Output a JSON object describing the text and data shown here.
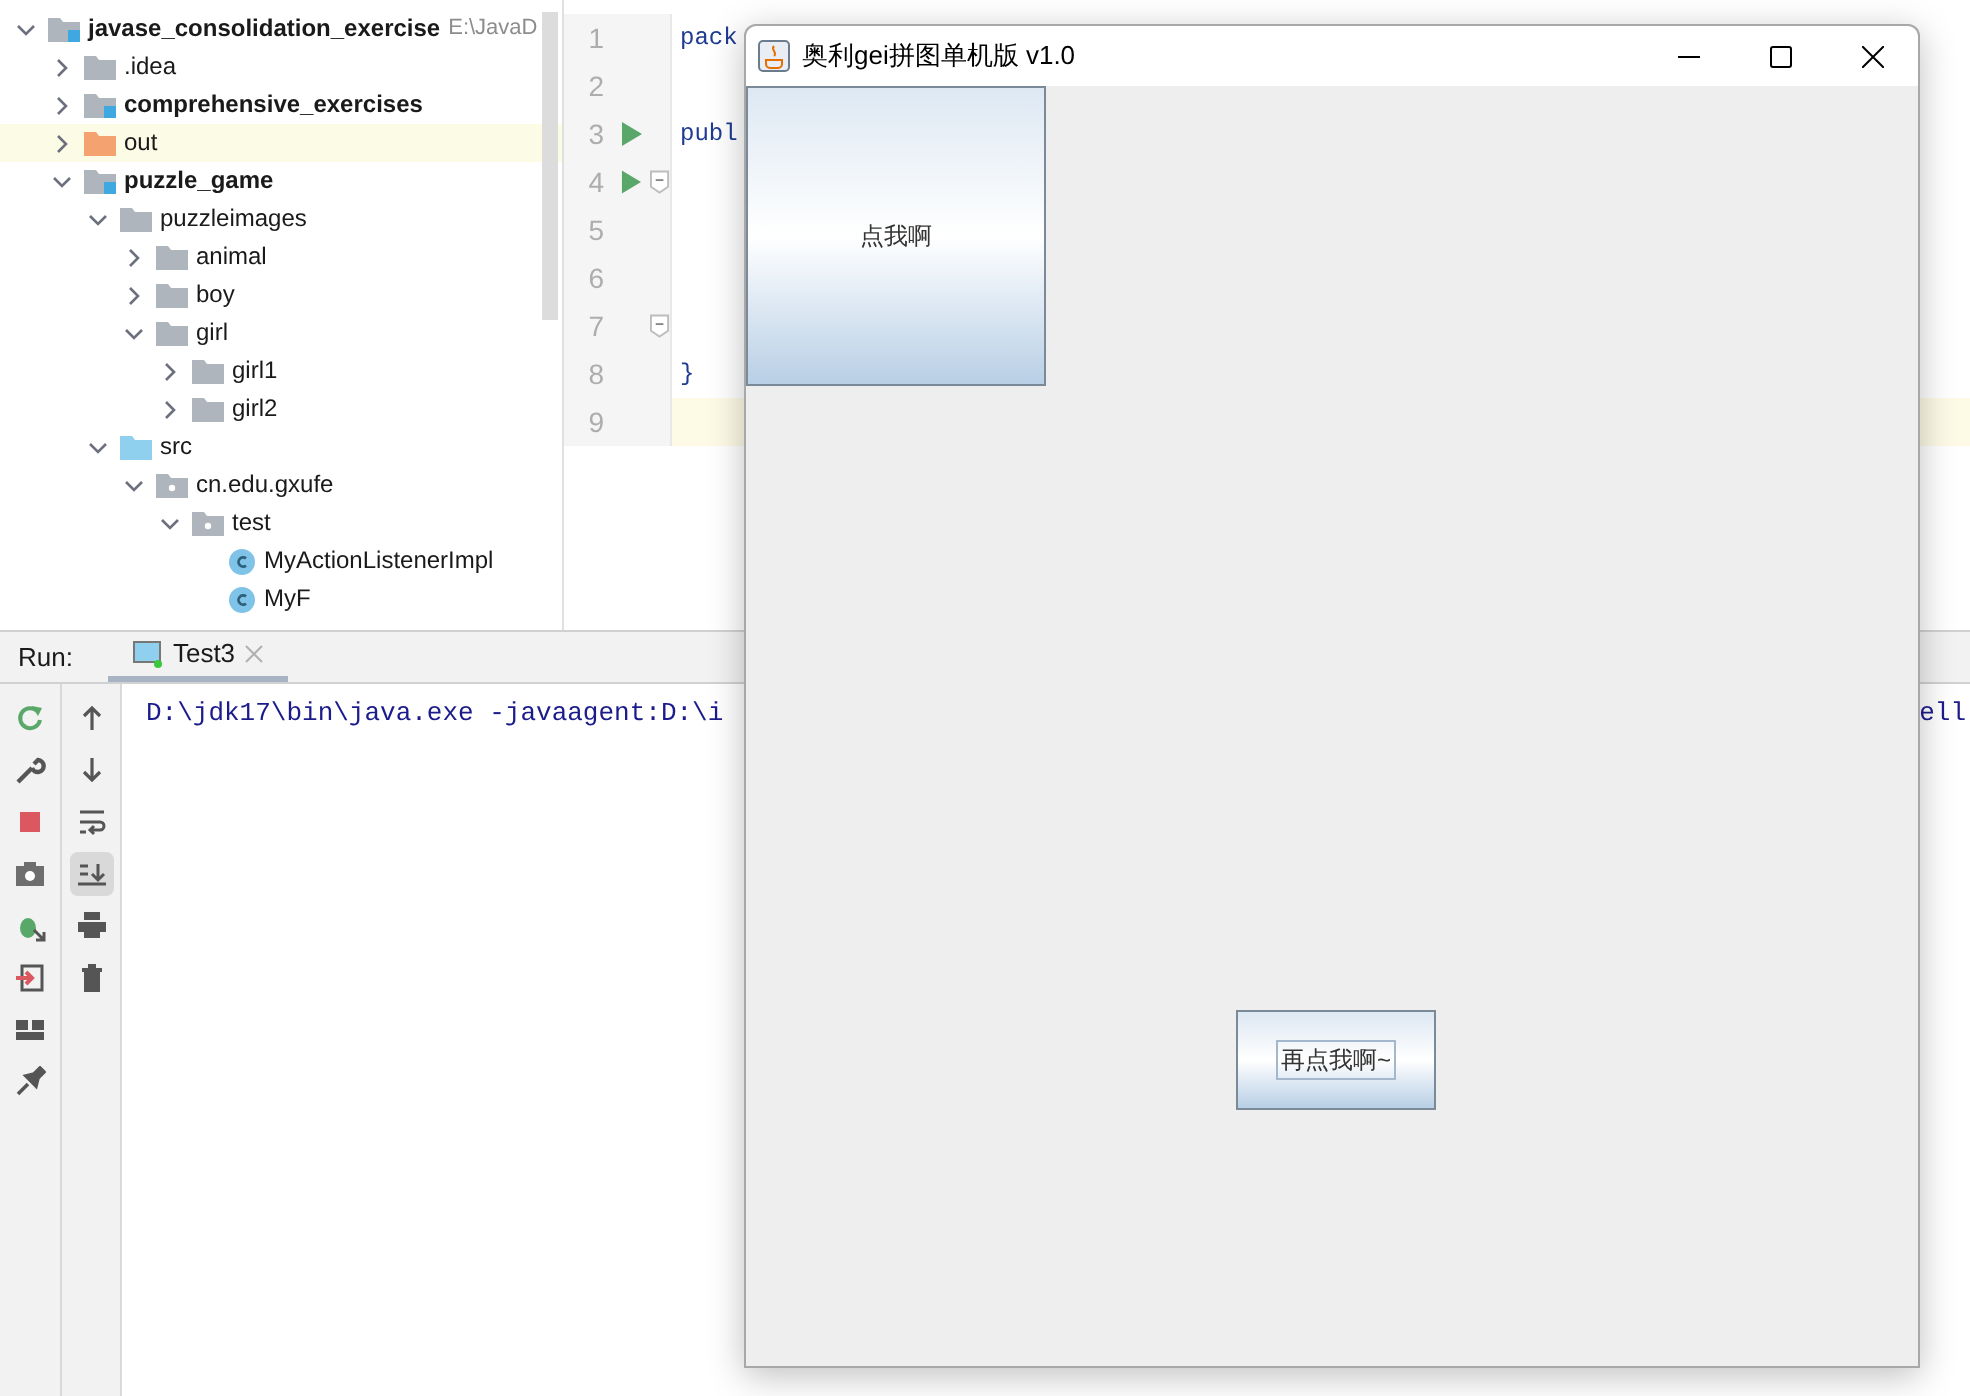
{
  "project_tree": {
    "items": [
      {
        "label": "javase_consolidation_exercise",
        "path": "E:\\JavaD",
        "kind": "module",
        "bold": true,
        "highlighted": false,
        "expanded": true,
        "children": [
          {
            "label": ".idea",
            "kind": "folder",
            "bold": false,
            "highlighted": false,
            "expanded": false
          },
          {
            "label": "comprehensive_exercises",
            "kind": "module",
            "bold": true,
            "highlighted": false,
            "expanded": false
          },
          {
            "label": "out",
            "kind": "excluded",
            "bold": false,
            "highlighted": true,
            "expanded": false
          },
          {
            "label": "puzzle_game",
            "kind": "module",
            "bold": true,
            "highlighted": false,
            "expanded": true,
            "children": [
              {
                "label": "puzzleimages",
                "kind": "folder",
                "bold": false,
                "highlighted": false,
                "expanded": true,
                "children": [
                  {
                    "label": "animal",
                    "kind": "folder",
                    "bold": false,
                    "highlighted": false,
                    "expanded": false
                  },
                  {
                    "label": "boy",
                    "kind": "folder",
                    "bold": false,
                    "highlighted": false,
                    "expanded": false
                  },
                  {
                    "label": "girl",
                    "kind": "folder",
                    "bold": false,
                    "highlighted": false,
                    "expanded": true,
                    "children": [
                      {
                        "label": "girl1",
                        "kind": "folder",
                        "bold": false,
                        "highlighted": false,
                        "expanded": false
                      },
                      {
                        "label": "girl2",
                        "kind": "folder",
                        "bold": false,
                        "highlighted": false,
                        "expanded": false
                      }
                    ]
                  }
                ]
              },
              {
                "label": "src",
                "kind": "source",
                "bold": false,
                "highlighted": false,
                "expanded": true,
                "children": [
                  {
                    "label": "cn.edu.gxufe",
                    "kind": "package",
                    "bold": false,
                    "highlighted": false,
                    "expanded": true,
                    "children": [
                      {
                        "label": "test",
                        "kind": "package",
                        "bold": false,
                        "highlighted": false,
                        "expanded": true,
                        "children": [
                          {
                            "label": "MyActionListenerImpl",
                            "kind": "class",
                            "bold": false,
                            "highlighted": false
                          },
                          {
                            "label": "MyF",
                            "kind": "class",
                            "bold": false,
                            "highlighted": false
                          }
                        ]
                      }
                    ]
                  }
                ]
              }
            ]
          }
        ]
      }
    ]
  },
  "editor": {
    "lines": [
      {
        "number": "1",
        "code": "pack",
        "run": false,
        "fold": false,
        "current": false
      },
      {
        "number": "2",
        "run": false,
        "fold": false,
        "current": false
      },
      {
        "number": "3",
        "code": "publ",
        "run": true,
        "fold": false,
        "current": false
      },
      {
        "number": "4",
        "run": true,
        "fold": true,
        "current": false
      },
      {
        "number": "5",
        "run": false,
        "fold": false,
        "current": false
      },
      {
        "number": "6",
        "run": false,
        "fold": false,
        "current": false
      },
      {
        "number": "7",
        "run": false,
        "fold": true,
        "current": false
      },
      {
        "number": "8",
        "code": "}",
        "run": false,
        "fold": false,
        "current": false
      },
      {
        "number": "9",
        "run": false,
        "fold": false,
        "current": true
      }
    ]
  },
  "run_panel": {
    "label": "Run:",
    "tabs": [
      {
        "label": "Test3",
        "selected": true
      }
    ],
    "console_lines": [
      "D:\\jdk17\\bin\\java.exe -javaagent:D:\\i"
    ],
    "console_right_fragment": "ell"
  },
  "app_window": {
    "title": "奥利gei拼图单机版 v1.0",
    "buttons": [
      {
        "label": "点我啊",
        "focused": false
      },
      {
        "label": "再点我啊~",
        "focused": true
      }
    ]
  }
}
